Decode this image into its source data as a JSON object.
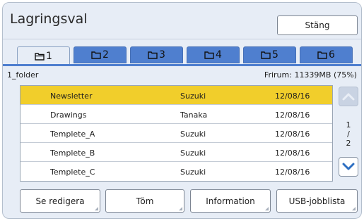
{
  "window": {
    "title": "Lagringsval",
    "close_label": "Stäng"
  },
  "tabs": [
    {
      "label": "1",
      "active": true
    },
    {
      "label": "2",
      "active": false
    },
    {
      "label": "3",
      "active": false
    },
    {
      "label": "4",
      "active": false
    },
    {
      "label": "5",
      "active": false
    },
    {
      "label": "6",
      "active": false
    }
  ],
  "folder_info": {
    "name": "1_folder",
    "free_space": "Frirum: 11339MB (75%)"
  },
  "files": [
    {
      "name": "Newsletter",
      "owner": "Suzuki",
      "date": "12/08/16",
      "selected": true
    },
    {
      "name": "Drawings",
      "owner": "Tanaka",
      "date": "12/08/16",
      "selected": false
    },
    {
      "name": "Templete_A",
      "owner": "Suzuki",
      "date": "12/08/16",
      "selected": false
    },
    {
      "name": "Templete_B",
      "owner": "Suzuki",
      "date": "12/08/16",
      "selected": false
    },
    {
      "name": "Templete_C",
      "owner": "Suzuki",
      "date": "12/08/16",
      "selected": false
    }
  ],
  "pager": {
    "current": "1",
    "separator": "/",
    "total": "2"
  },
  "actions": {
    "edit": "Se redigera",
    "empty": "Töm",
    "info": "Information",
    "usb": "USB-jobblista"
  },
  "colors": {
    "selected_row": "#f1ce2b",
    "tab_blue": "#4f7fcf",
    "panel_bg": "#e7edf6",
    "arrow_blue": "#2d6fc2"
  },
  "icons": {
    "tab_icon": "folder-icon",
    "scroll_up": "chevron-up-icon",
    "scroll_down": "chevron-down-icon"
  }
}
